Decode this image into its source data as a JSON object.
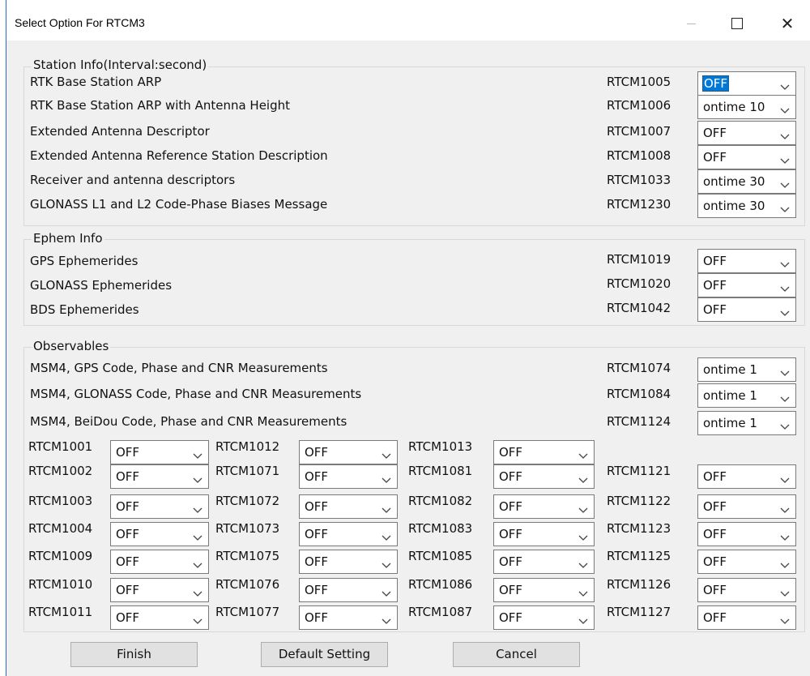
{
  "window": {
    "title": "Select Option For RTCM3"
  },
  "groups": {
    "station": "Station Info(Interval:second)",
    "ephem": "Ephem Info",
    "observables": "Observables"
  },
  "station_rows": [
    {
      "label": "RTK Base Station ARP",
      "code": "RTCM1005",
      "value": "OFF"
    },
    {
      "label": "RTK Base Station ARP with Antenna Height",
      "code": "RTCM1006",
      "value": "ontime 10"
    },
    {
      "label": "Extended Antenna Descriptor",
      "code": "RTCM1007",
      "value": "OFF"
    },
    {
      "label": "Extended Antenna Reference Station Description",
      "code": "RTCM1008",
      "value": "OFF"
    },
    {
      "label": "Receiver and antenna descriptors",
      "code": "RTCM1033",
      "value": "ontime 30"
    },
    {
      "label": "GLONASS L1 and L2 Code-Phase Biases Message",
      "code": "RTCM1230",
      "value": "ontime 30"
    }
  ],
  "ephem_rows": [
    {
      "label": "GPS Ephemerides",
      "code": "RTCM1019",
      "value": "OFF"
    },
    {
      "label": "GLONASS Ephemerides",
      "code": "RTCM1020",
      "value": "OFF"
    },
    {
      "label": "BDS Ephemerides",
      "code": "RTCM1042",
      "value": "OFF"
    }
  ],
  "msm_rows": [
    {
      "label": "MSM4, GPS Code, Phase and CNR Measurements",
      "code": "RTCM1074",
      "value": "ontime 1"
    },
    {
      "label": "MSM4, GLONASS Code, Phase and CNR Measurements",
      "code": "RTCM1084",
      "value": "ontime 1"
    },
    {
      "label": "MSM4, BeiDou Code, Phase and CNR Measurements",
      "code": "RTCM1124",
      "value": "ontime 1"
    }
  ],
  "grid": {
    "col1": [
      {
        "code": "RTCM1001",
        "value": "OFF"
      },
      {
        "code": "RTCM1002",
        "value": "OFF"
      },
      {
        "code": "RTCM1003",
        "value": "OFF"
      },
      {
        "code": "RTCM1004",
        "value": "OFF"
      },
      {
        "code": "RTCM1009",
        "value": "OFF"
      },
      {
        "code": "RTCM1010",
        "value": "OFF"
      },
      {
        "code": "RTCM1011",
        "value": "OFF"
      }
    ],
    "col2": [
      {
        "code": "RTCM1012",
        "value": "OFF"
      },
      {
        "code": "RTCM1071",
        "value": "OFF"
      },
      {
        "code": "RTCM1072",
        "value": "OFF"
      },
      {
        "code": "RTCM1073",
        "value": "OFF"
      },
      {
        "code": "RTCM1075",
        "value": "OFF"
      },
      {
        "code": "RTCM1076",
        "value": "OFF"
      },
      {
        "code": "RTCM1077",
        "value": "OFF"
      }
    ],
    "col3": [
      {
        "code": "RTCM1013",
        "value": "OFF"
      },
      {
        "code": "RTCM1081",
        "value": "OFF"
      },
      {
        "code": "RTCM1082",
        "value": "OFF"
      },
      {
        "code": "RTCM1083",
        "value": "OFF"
      },
      {
        "code": "RTCM1085",
        "value": "OFF"
      },
      {
        "code": "RTCM1086",
        "value": "OFF"
      },
      {
        "code": "RTCM1087",
        "value": "OFF"
      }
    ],
    "col4": [
      {
        "code": "RTCM1121",
        "value": "OFF"
      },
      {
        "code": "RTCM1122",
        "value": "OFF"
      },
      {
        "code": "RTCM1123",
        "value": "OFF"
      },
      {
        "code": "RTCM1125",
        "value": "OFF"
      },
      {
        "code": "RTCM1126",
        "value": "OFF"
      },
      {
        "code": "RTCM1127",
        "value": "OFF"
      }
    ]
  },
  "buttons": {
    "finish": "Finish",
    "default": "Default Setting",
    "cancel": "Cancel"
  },
  "icons": {
    "minimize": "minimize-icon",
    "maximize": "maximize-icon",
    "close": "close-icon",
    "dropdown": "chevron-down-icon"
  },
  "colors": {
    "selection_highlight": "#0078d7",
    "dialog_bg": "#f0f0f0"
  }
}
